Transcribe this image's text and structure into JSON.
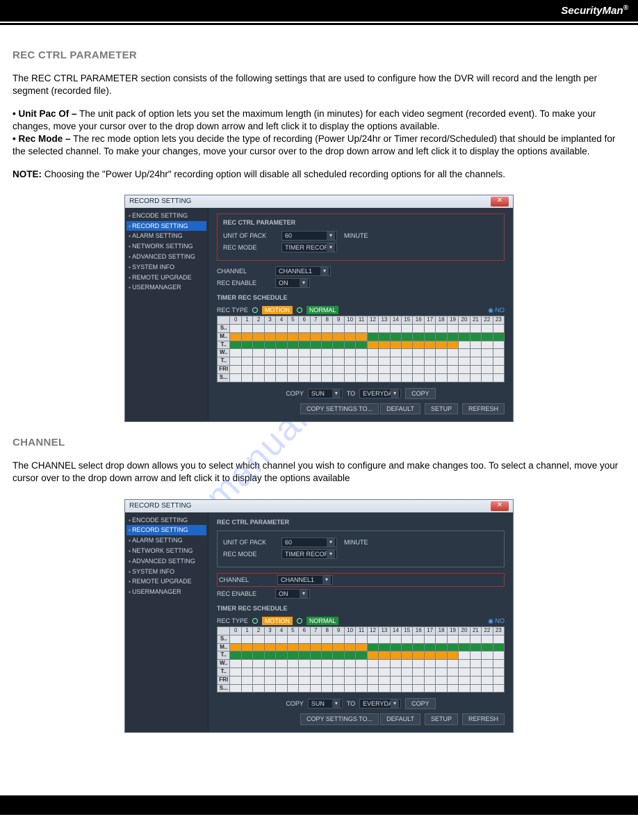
{
  "brand": "SecurityMan",
  "brand_suffix": "®",
  "watermark": "manualshive.com",
  "section1": {
    "title": "REC CTRL PARAMETER",
    "intro": "The REC CTRL PARAMETER section consists of the following settings that are used to configure how the DVR will record and the length per segment (recorded file).",
    "bullet1_label": "• Unit Pac Of –",
    "bullet1_text": " The unit pack of option lets you set the maximum length (in minutes) for each video segment (recorded event). To make your changes, move your cursor over to the drop down arrow and left click it to display the options available.",
    "bullet2_label": "• Rec Mode –",
    "bullet2_text": " The rec mode option lets you decide the type of recording (Power Up/24hr or Timer record/Scheduled) that should be implanted for the selected channel. To make your changes, move your cursor over to the drop down arrow and left click it to display the options available.",
    "note_label": "NOTE:",
    "note_text": " Choosing the \"Power Up/24hr\" recording option will disable all scheduled recording options for all the channels."
  },
  "section2": {
    "title": "CHANNEL",
    "intro": "The CHANNEL select drop down allows you to select which channel you wish to configure and make changes too.  To select a channel, move your cursor over to the drop down arrow and left click it to display the options available"
  },
  "app": {
    "window_title": "RECORD SETTING",
    "tree": [
      "ENCODE SETTING",
      "RECORD SETTING",
      "ALARM SETTING",
      "NETWORK SETTING",
      "ADVANCED SETTING",
      "SYSTEM INFO",
      "REMOTE UPGRADE",
      "USERMANAGER"
    ],
    "selected_tree_index": 1,
    "panel_title": "REC CTRL PARAMETER",
    "unit_label": "UNIT OF PACK",
    "unit_value": "60",
    "unit_suffix": "MINUTE",
    "recmode_label": "REC MODE",
    "recmode_value": "TIMER RECORD",
    "channel_label": "CHANNEL",
    "channel_value": "CHANNEL1",
    "recenable_label": "REC ENABLE",
    "recenable_value": "ON",
    "sched_title": "TIMER REC SCHEDULE",
    "rectype_label": "REC TYPE",
    "rectype_motion": "MOTION",
    "rectype_normal": "NORMAL",
    "rectype_no": "NO",
    "hours": [
      "0",
      "1",
      "2",
      "3",
      "4",
      "5",
      "6",
      "7",
      "8",
      "9",
      "10",
      "11",
      "12",
      "13",
      "14",
      "15",
      "16",
      "17",
      "18",
      "19",
      "20",
      "21",
      "22",
      "23"
    ],
    "days": [
      "S..",
      "M..",
      "T..",
      "W..",
      "T..",
      "FRI",
      "S..."
    ],
    "copy_label": "COPY",
    "copy_from": "SUN",
    "copy_to_label": "TO",
    "copy_to": "EVERYDAY",
    "copy_btn": "COPY",
    "copy_settings_btn": "COPY SETTINGS TO...",
    "btn_default": "DEFAULT",
    "btn_setup": "SETUP",
    "btn_refresh": "REFRESH"
  }
}
